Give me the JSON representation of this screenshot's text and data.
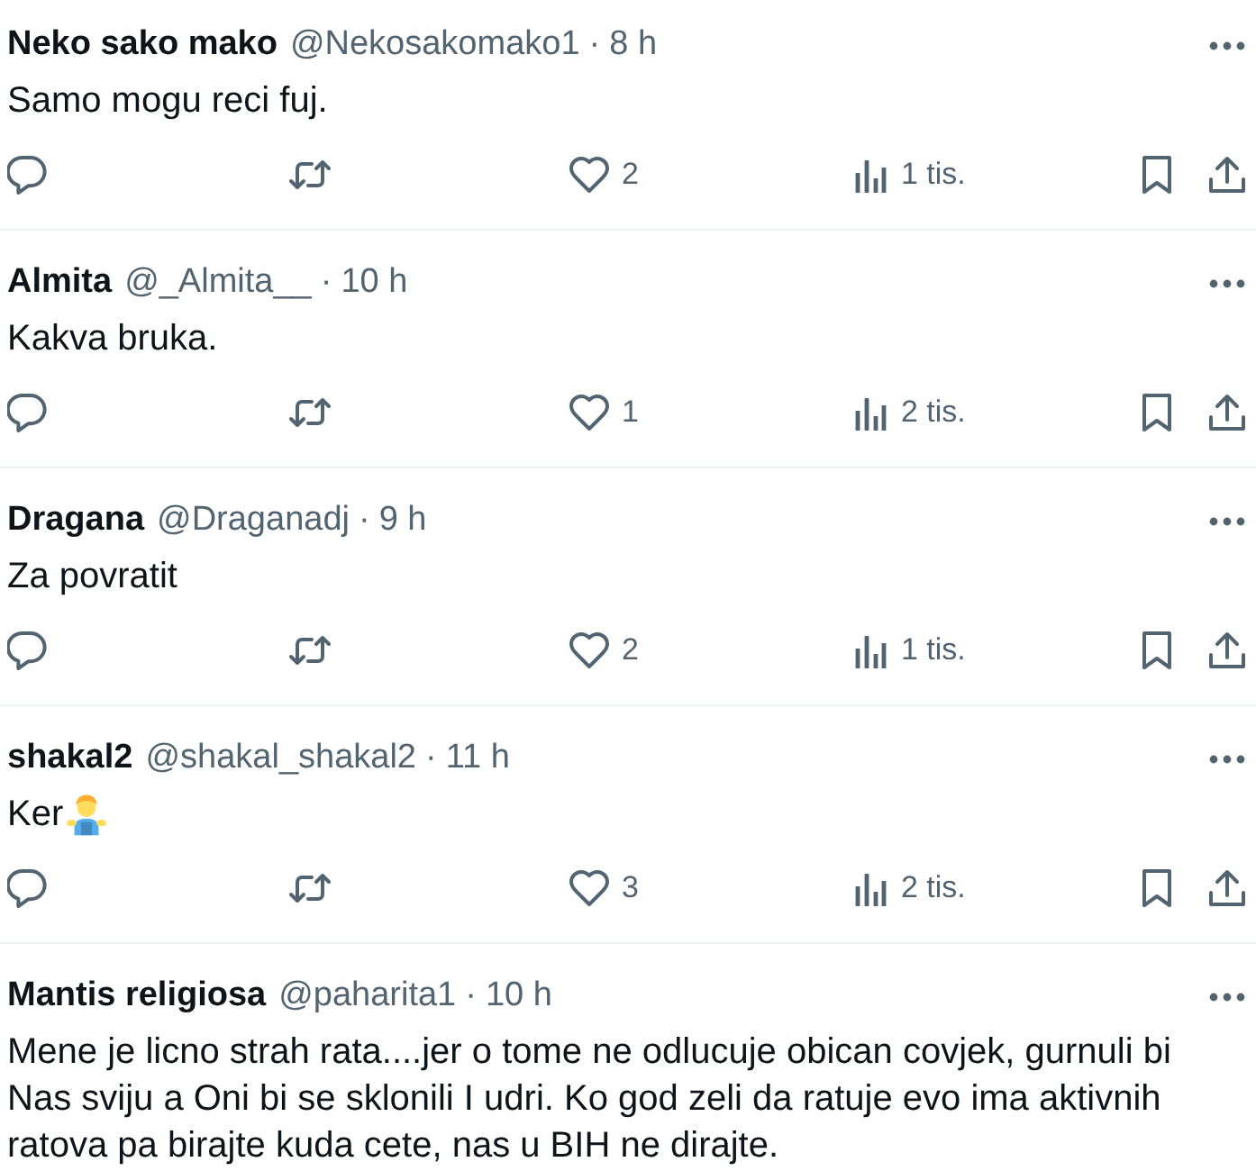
{
  "replies": [
    {
      "name": "Neko sako mako",
      "handle": "@Nekosakomako1",
      "separator": "·",
      "time": "8 h",
      "kind": "text",
      "text": "Samo mogu reci fuj.",
      "stats": {
        "likes": "2",
        "views": "1 tis."
      }
    },
    {
      "name": "Almita",
      "handle": "@_Almita__",
      "separator": "·",
      "time": "10 h",
      "kind": "text",
      "text": "Kakva bruka.",
      "stats": {
        "likes": "1",
        "views": "2 tis."
      }
    },
    {
      "name": "Dragana",
      "handle": "@Draganadj",
      "separator": "·",
      "time": "9 h",
      "kind": "text",
      "text": "Za povratit",
      "stats": {
        "likes": "2",
        "views": "1 tis."
      }
    },
    {
      "name": "shakal2",
      "handle": "@shakal_shakal2",
      "separator": "·",
      "time": "11 h",
      "kind": "text_with_emoji",
      "text": "Ker",
      "stats": {
        "likes": "3",
        "views": "2 tis."
      }
    },
    {
      "name": "Mantis religiosa",
      "handle": "@paharita1",
      "separator": "·",
      "time": "10 h",
      "kind": "text",
      "text": "Mene je licno strah rata....jer o tome ne odlucuje obican covjek, gurnuli bi Nas sviju a Oni bi se sklonili I udri. Ko god zeli da ratuje evo ima aktivnih ratova pa birajte kuda cete, nas u BIH ne dirajte."
    }
  ]
}
